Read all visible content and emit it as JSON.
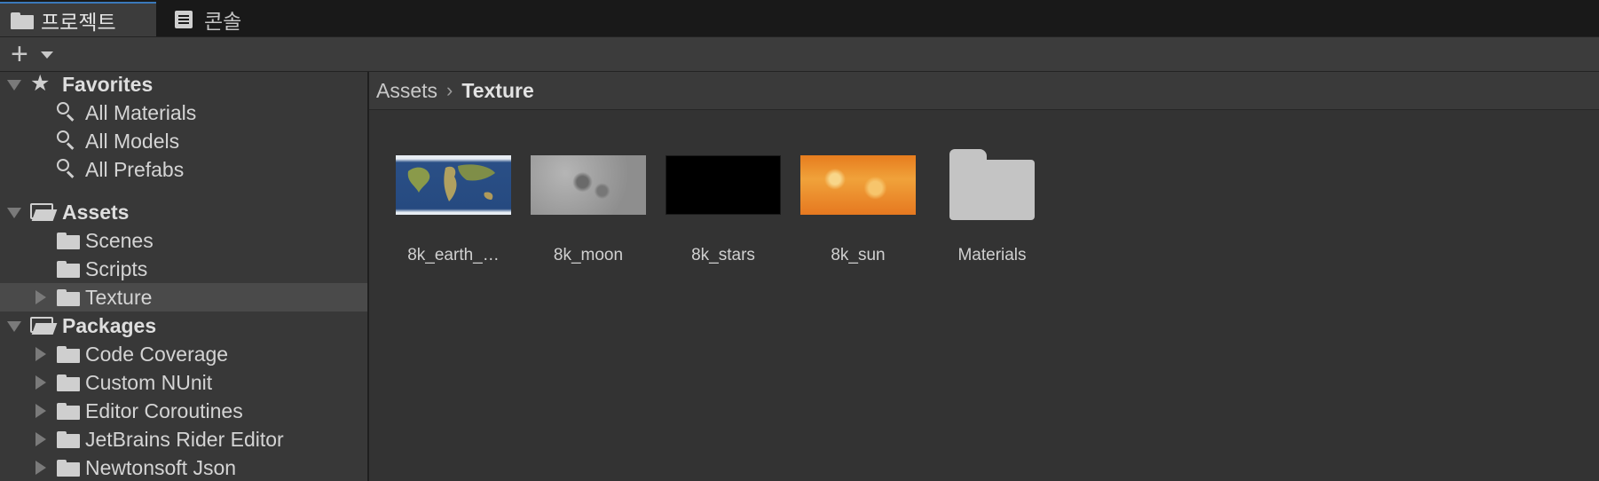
{
  "tabs": [
    {
      "label": "프로젝트",
      "icon": "folder-icon",
      "active": true
    },
    {
      "label": "콘솔",
      "icon": "console-icon",
      "active": false
    }
  ],
  "toolbar": {
    "add_label": "+",
    "add_icon": "plus-icon"
  },
  "tree": {
    "favorites": {
      "label": "Favorites",
      "items": [
        "All Materials",
        "All Models",
        "All Prefabs"
      ]
    },
    "assets": {
      "label": "Assets",
      "items": [
        "Scenes",
        "Scripts",
        "Texture"
      ]
    },
    "packages": {
      "label": "Packages",
      "items": [
        "Code Coverage",
        "Custom NUnit",
        "Editor Coroutines",
        "JetBrains Rider Editor",
        "Newtonsoft Json"
      ]
    }
  },
  "breadcrumb": {
    "root": "Assets",
    "current": "Texture"
  },
  "assets": [
    {
      "label": "8k_earth_…",
      "type": "texture"
    },
    {
      "label": "8k_moon",
      "type": "texture"
    },
    {
      "label": "8k_stars",
      "type": "texture"
    },
    {
      "label": "8k_sun",
      "type": "texture"
    },
    {
      "label": "Materials",
      "type": "folder"
    }
  ],
  "colors": {
    "accent": "#3a79bb",
    "panel": "#383838",
    "selected": "#4a4a4a"
  }
}
